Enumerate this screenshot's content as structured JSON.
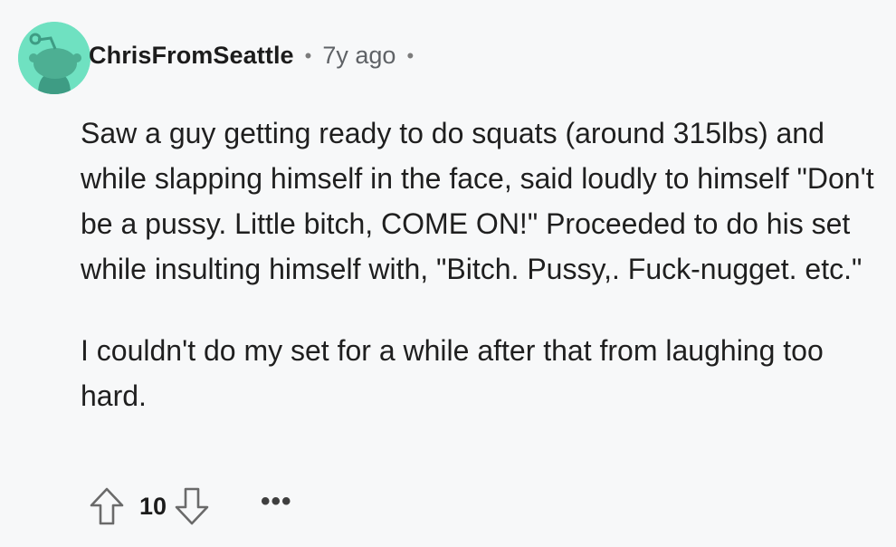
{
  "comment": {
    "username": "ChrisFromSeattle",
    "separator": "•",
    "timestamp": "7y ago",
    "trailing_separator": "•",
    "paragraphs": [
      "Saw a guy getting ready to do squats (around 315lbs) and while slapping himself in the face, said loudly to himself \"Don't be a pussy. Little bitch, COME ON!\" Proceeded to do his set while insulting himself with, \"Bitch. Pussy,. Fuck-nugget. etc.\"",
      "I couldn't do my set for a while after that from laughing too hard."
    ]
  },
  "actions": {
    "score": "10",
    "more_label": "•••",
    "upvote_icon": "arrow-up-outline-icon",
    "downvote_icon": "arrow-down-outline-icon"
  },
  "colors": {
    "background": "#f7f8f9",
    "avatar_bg": "#6fe1c1",
    "text": "#1f1f1f",
    "muted": "#5f6266"
  }
}
